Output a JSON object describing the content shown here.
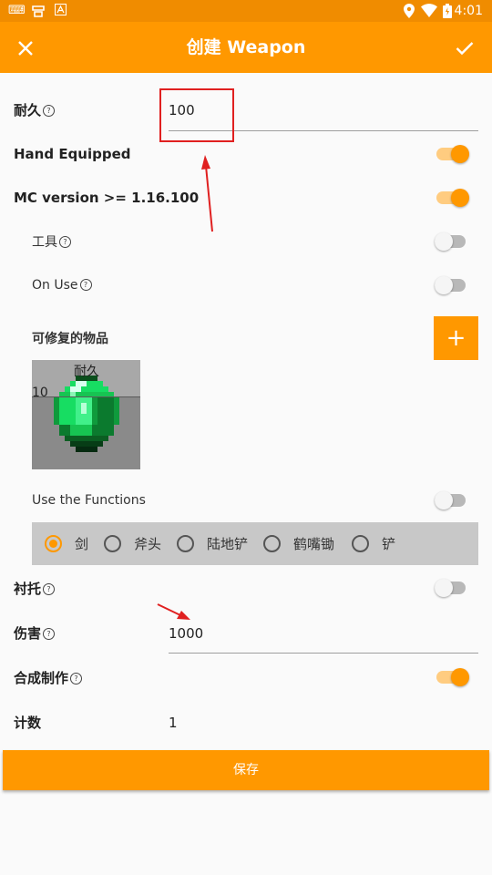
{
  "status_bar": {
    "time": "4:01",
    "icons": [
      "keyboard-icon",
      "app-icon",
      "font-icon",
      "location-icon",
      "wifi-icon",
      "battery-icon"
    ]
  },
  "app_bar": {
    "title": "创建 Weapon",
    "close_icon": "close-icon",
    "confirm_icon": "check-icon"
  },
  "form": {
    "durability": {
      "label": "耐久",
      "value": "100"
    },
    "hand_equipped": {
      "label": "Hand Equipped",
      "on": true
    },
    "mc_version": {
      "label": "MC version >= 1.16.100",
      "on": true
    },
    "tool": {
      "label": "工具",
      "on": false
    },
    "on_use": {
      "label": "On Use",
      "on": false
    },
    "repair_items": {
      "label": "可修复的物品",
      "add_label": "+",
      "item": {
        "label": "耐久",
        "value": "10",
        "icon": "emerald-icon"
      }
    },
    "use_functions": {
      "label": "Use the Functions",
      "on": false
    },
    "tool_types": [
      {
        "label": "剑",
        "selected": true
      },
      {
        "label": "斧头",
        "selected": false
      },
      {
        "label": "陆地铲",
        "selected": false
      },
      {
        "label": "鹤嘴锄",
        "selected": false
      },
      {
        "label": "铲",
        "selected": false
      }
    ],
    "offhand": {
      "label": "衬托",
      "on": false
    },
    "damage": {
      "label": "伤害",
      "value": "1000"
    },
    "crafting": {
      "label": "合成制作",
      "on": true
    },
    "count": {
      "label": "计数",
      "value": "1"
    }
  },
  "save_label": "保存",
  "colors": {
    "accent": "#ff9800",
    "status_bar": "#f08c00",
    "annotation": "#e02020"
  }
}
